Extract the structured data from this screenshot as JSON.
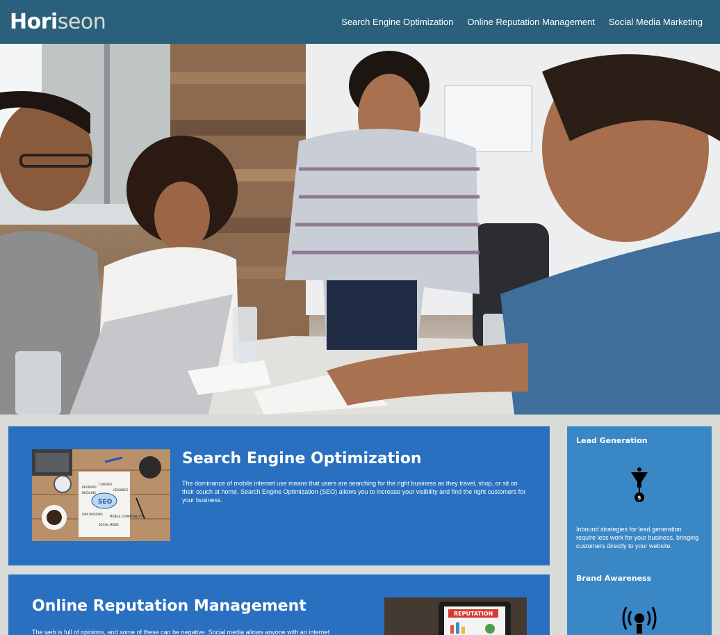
{
  "header": {
    "logo_main": "Hori",
    "logo_accent": "seon",
    "nav": [
      {
        "label": "Search Engine Optimization"
      },
      {
        "label": "Online Reputation Management"
      },
      {
        "label": "Social Media Marketing"
      }
    ]
  },
  "content": [
    {
      "title": "Search Engine Optimization",
      "text": "The dominance of mobile internet use means that users are searching for the right business as they travel, shop, or sit on their couch at home. Search Engine Optimization (SEO) allows you to increase your visibility and find the right customers for your business."
    },
    {
      "title": "Online Reputation Management",
      "text": "The web is full of opinions, and some of these can be negative. Social media allows anyone with an internet"
    }
  ],
  "sidebar": [
    {
      "title": "Lead Generation",
      "text": "Inbound strategies for lead generation require less work for your business, bringing customers directly to your website."
    },
    {
      "title": "Brand Awareness"
    }
  ],
  "thumb_seo_words": [
    "SEO",
    "CONTENT",
    "KEYWORD",
    "BACKLINK",
    "HEADINGS",
    "LINK BUILDING",
    "MOBILE COMPATIBILITY",
    "SOCIAL MEDIA"
  ],
  "thumb_rep_word": "REPUTATION",
  "colors": {
    "header_bg": "#2a607c",
    "page_bg": "#d9dcd6",
    "card_bg": "#2a70c0",
    "sidebar_bg": "#3a87c6"
  }
}
